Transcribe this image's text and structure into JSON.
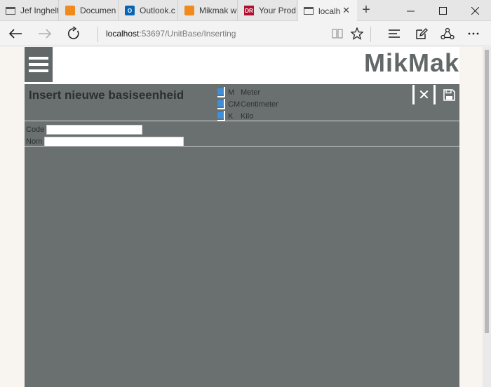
{
  "browser": {
    "tabs": [
      {
        "title": "Jef Inghelt",
        "icon": "page-icon"
      },
      {
        "title": "Documen",
        "icon": "orange-app-icon"
      },
      {
        "title": "Outlook.c",
        "icon": "outlook-icon"
      },
      {
        "title": "Mikmak w",
        "icon": "orange-app-icon"
      },
      {
        "title": "Your Prod",
        "icon": "dr-icon",
        "icon_text": "DR"
      },
      {
        "title": "localh",
        "icon": "page-icon",
        "active": true
      }
    ],
    "outlook_icon_text": "O",
    "new_tab_symbol": "+",
    "tab_close_symbol": "✕",
    "address": {
      "host": "localhost",
      "rest": ":53697/UnitBase/Inserting"
    }
  },
  "app": {
    "brand": "MikMak",
    "page_title": "Insert nieuwe basiseenheid",
    "units": [
      {
        "code": "M",
        "name": "Meter"
      },
      {
        "code": "CM",
        "name": "Centimeter"
      },
      {
        "code": "K",
        "name": "Kilo"
      }
    ],
    "close_symbol": "✕",
    "form": {
      "code_label": "Code",
      "code_value": "",
      "name_label": "Nom",
      "name_value": ""
    }
  },
  "colors": {
    "app_background": "#6a7070",
    "accent_blue": "#3d8fdc"
  }
}
